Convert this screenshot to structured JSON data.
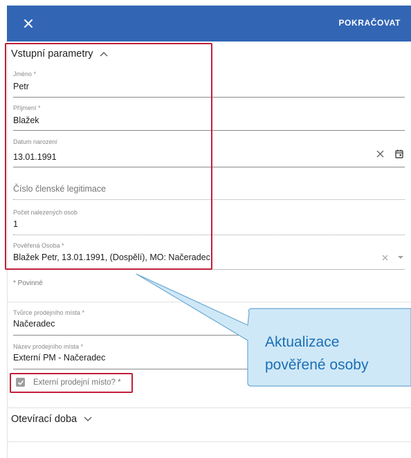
{
  "toolbar": {
    "close_icon": "close-icon",
    "continue_label": "POKRAČOVAT",
    "background": "#3266b4"
  },
  "section_input": {
    "title": "Vstupní parametry",
    "expanded": true
  },
  "fields": {
    "first_name": {
      "label": "Jméno *",
      "value": "Petr"
    },
    "last_name": {
      "label": "Příjmení *",
      "value": "Blažek"
    },
    "birth_date": {
      "label": "Datum narození",
      "value": "13.01.1991"
    },
    "card_number": {
      "placeholder": "Číslo členské legitimace"
    },
    "found_count": {
      "label": "Počet nalezených osob",
      "value": "1"
    },
    "authorized_person": {
      "label": "Pověřená Osoba *",
      "value": "Blažek Petr, 13.01.1991, (Dospělí), MO: Načeradec"
    },
    "required_note": "* Povinné",
    "pos_creator": {
      "label": "Tvůrce prodejního místa *",
      "value": "Načeradec"
    },
    "pos_name": {
      "label": "Název prodejního místa *",
      "value": "Externí PM - Načeradec"
    },
    "external_pos": {
      "label": "Externí prodejní místo? *",
      "checked": true
    }
  },
  "section_hours": {
    "title": "Otevírací doba",
    "expanded": false
  },
  "callout": {
    "line1": "Aktualizace",
    "line2": "pověřené osoby",
    "fill": "#cfe8f7",
    "stroke": "#6aa8d4",
    "text_color": "#1a6fb5"
  },
  "highlight_color": "#c01f3a"
}
